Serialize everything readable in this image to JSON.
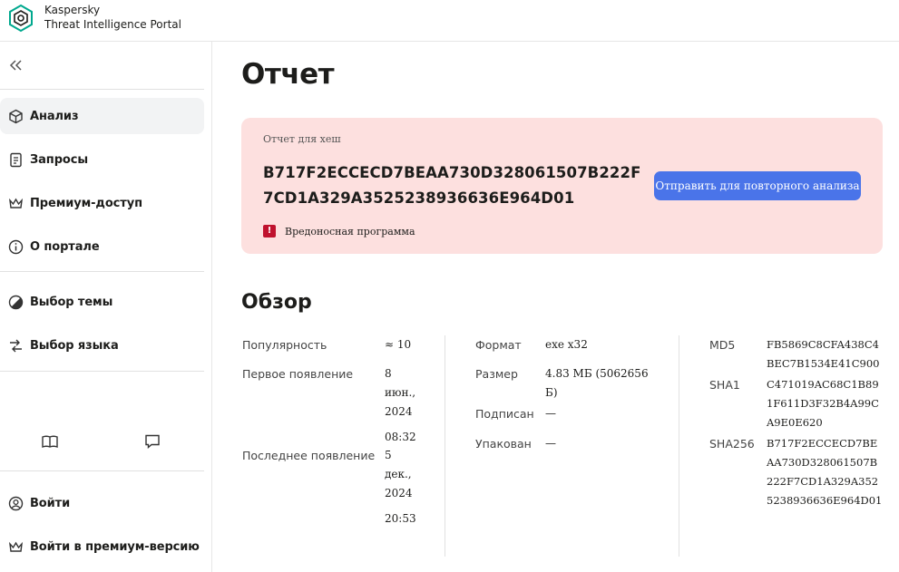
{
  "header": {
    "brand_line1": "Kaspersky",
    "brand_line2": "Threat Intelligence Portal"
  },
  "sidebar": {
    "items": [
      {
        "label": "Анализ",
        "icon": "cube-icon",
        "active": true
      },
      {
        "label": "Запросы",
        "icon": "document-icon"
      },
      {
        "label": "Премиум-доступ",
        "icon": "crown-icon"
      },
      {
        "label": "О портале",
        "icon": "info-icon"
      }
    ],
    "settings": [
      {
        "label": "Выбор темы",
        "icon": "theme-icon"
      },
      {
        "label": "Выбор языка",
        "icon": "language-icon"
      }
    ],
    "account": [
      {
        "label": "Войти",
        "icon": "user-icon"
      },
      {
        "label": "Войти в премиум-версию",
        "icon": "crown-icon"
      }
    ]
  },
  "main": {
    "title": "Отчет",
    "report": {
      "label": "Отчет для хеш",
      "hash": "B717F2ECCECD7BEAA730D328061507B222F7CD1A329A3525238936636E964D01",
      "verdict": "Вредоносная программа",
      "reanalyze_button": "Отправить для повторного анализа"
    },
    "overview": {
      "title": "Обзор",
      "popularity_label": "Популярность",
      "popularity_value": "≈ 10",
      "first_seen_label": "Первое появление",
      "first_seen_date_1": "8",
      "first_seen_date_2": "июн.,",
      "first_seen_date_3": "2024",
      "first_seen_time": "08:32",
      "last_seen_label": "Последнее появление",
      "last_seen_date_1": "5",
      "last_seen_date_2": "дек.,",
      "last_seen_date_3": "2024",
      "last_seen_time": "20:53",
      "format_label": "Формат",
      "format_value": "exe x32",
      "size_label": "Размер",
      "size_value": "4.83 МБ (5062656 Б)",
      "signed_label": "Подписан",
      "signed_value": "—",
      "packed_label": "Упакован",
      "packed_value": "—",
      "md5_label": "MD5",
      "md5_value": "FB5869C8CFA438C4BEC7B1534E41C900",
      "sha1_label": "SHA1",
      "sha1_value": "C471019AC68C1B891F611D3F32B4A99CA9E0E620",
      "sha256_label": "SHA256",
      "sha256_value": "B717F2ECCECD7BEAA730D328061507B222F7CD1A329A3525238936636E964D01"
    }
  },
  "colors": {
    "accent": "#4a74e9",
    "alert_bg": "#fde0df",
    "malware": "#c0122e"
  }
}
